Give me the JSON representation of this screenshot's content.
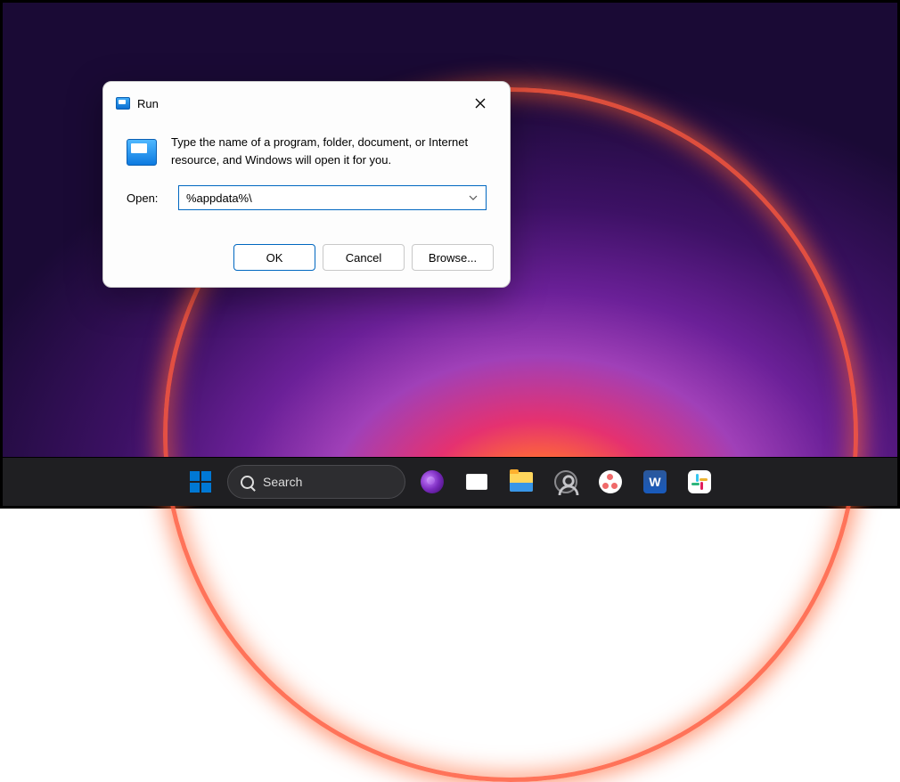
{
  "dialog": {
    "title": "Run",
    "info": "Type the name of a program, folder, document, or Internet resource, and Windows will open it for you.",
    "open_label": "Open:",
    "open_value": "%appdata%\\",
    "buttons": {
      "ok": "OK",
      "cancel": "Cancel",
      "browse": "Browse..."
    }
  },
  "taskbar": {
    "search_placeholder": "Search"
  }
}
